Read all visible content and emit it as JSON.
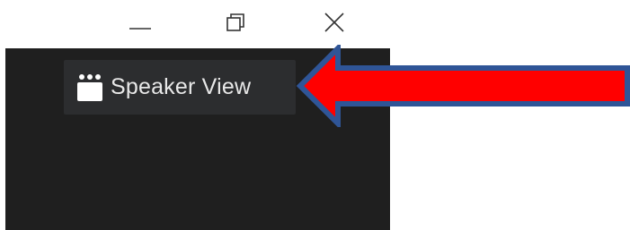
{
  "window_controls": {
    "minimize_icon": "minimize-icon",
    "restore_icon": "restore-icon",
    "close_icon": "close-icon"
  },
  "view_toggle": {
    "label": "Speaker View",
    "icon": "speaker-view-icon"
  },
  "annotation": {
    "type": "arrow",
    "fill_color": "#ff0000",
    "outline_color": "#2f5597"
  },
  "colors": {
    "panel_background": "#1f1f1f",
    "button_background": "#2c2d2f",
    "button_text": "#e8e8e8"
  }
}
